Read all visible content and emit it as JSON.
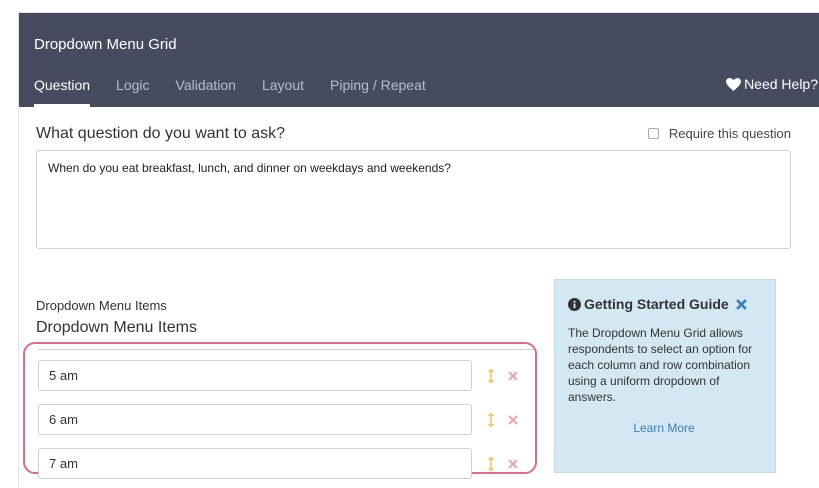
{
  "header": {
    "title": "Dropdown Menu Grid",
    "tabs": [
      {
        "label": "Question",
        "active": true
      },
      {
        "label": "Logic",
        "active": false
      },
      {
        "label": "Validation",
        "active": false
      },
      {
        "label": "Layout",
        "active": false
      },
      {
        "label": "Piping / Repeat",
        "active": false
      }
    ],
    "help_label": "Need Help?"
  },
  "question": {
    "label": "What question do you want to ask?",
    "require_label": "Require this question",
    "require_checked": false,
    "text": "When do you eat breakfast, lunch, and dinner on weekdays and weekends?"
  },
  "dropdown": {
    "subtitle": "Dropdown Menu Items",
    "title": "Dropdown Menu Items",
    "items": [
      {
        "value": "5 am"
      },
      {
        "value": "6 am"
      },
      {
        "value": "7 am"
      }
    ]
  },
  "guide": {
    "title": "Getting Started Guide",
    "body": "The Dropdown Menu Grid allows respondents to select an option for each column and row combination using a uniform dropdown of answers.",
    "link": "Learn More"
  },
  "icons": {
    "help": "heart-icon",
    "info": "info-circle-icon",
    "close": "close-icon",
    "drag": "drag-handle-icon",
    "delete": "delete-icon"
  },
  "colors": {
    "header_bg": "#464b60",
    "highlight": "#e06a8c",
    "guide_bg": "#d3e8f3",
    "close": "#3b7fb8",
    "link": "#3b7fb8"
  }
}
